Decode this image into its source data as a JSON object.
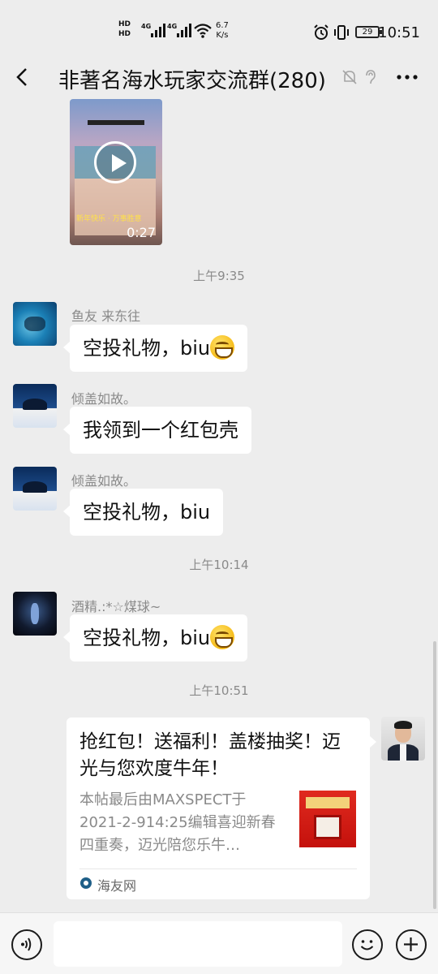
{
  "status_bar": {
    "hd1": "HD",
    "hd2": "HD",
    "net_type_1": "4G",
    "net_type_2": "4G",
    "speed_value": "6.7",
    "speed_unit": "K/s",
    "battery": "29",
    "time": "10:51"
  },
  "header": {
    "title": "非著名海水玩家交流群(280)"
  },
  "video_message": {
    "caption": "新年快乐 · 万事胜意",
    "duration": "0:27"
  },
  "timestamps": {
    "t1": "上午9:35",
    "t2": "上午10:14",
    "t3": "上午10:51"
  },
  "messages": [
    {
      "sender": "鱼友 来东往",
      "text": "空投礼物，biu",
      "emoji": "grin-emoji"
    },
    {
      "sender": "倾盖如故。",
      "text": "我领到一个红包壳"
    },
    {
      "sender": "倾盖如故。",
      "text": "空投礼物，biu"
    },
    {
      "sender": "酒精.:*☆煤球~",
      "text": "空投礼物，biu",
      "emoji": "grin-emoji"
    }
  ],
  "link_card": {
    "title": "抢红包！送福利！盖楼抽奖！迈光与您欢度牛年！",
    "description": "本帖最后由MAXSPECT于2021-2-914:25编辑喜迎新春四重奏，迈光陪您乐牛…",
    "source": "海友网"
  },
  "input": {
    "value": ""
  },
  "icons": {
    "back": "back-arrow-icon",
    "mute": "mute-bell-icon",
    "ear": "ear-icon",
    "more": "more-icon",
    "voice": "voice-icon",
    "emoji": "emoji-icon",
    "add": "add-icon"
  }
}
